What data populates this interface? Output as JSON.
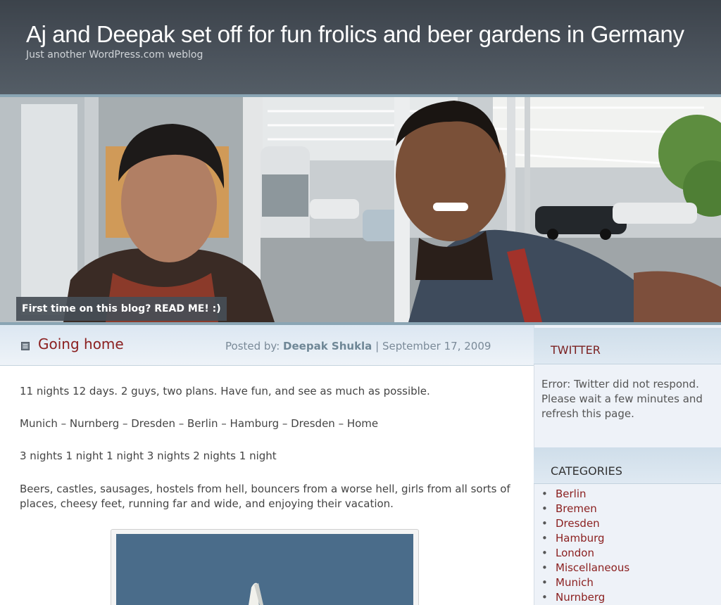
{
  "site": {
    "title": "Aj and Deepak set off for fun frolics and beer gardens in Germany",
    "description": "Just another WordPress.com weblog"
  },
  "banner": {
    "readme_label": "First time on this blog? READ ME! :)"
  },
  "post": {
    "title": "Going home",
    "posted_by_label": "Posted by:",
    "author": "Deepak Shukla",
    "separator": "|",
    "date": "September 17, 2009",
    "paragraphs": [
      "11 nights 12 days. 2 guys, two plans. Have fun, and see as much as possible.",
      "Munich – Nurnberg – Dresden – Berlin – Hamburg – Dresden – Home",
      "3 nights 1 night 1 night 3 nights 2 nights 1 night",
      "Beers, castles, sausages, hostels from hell, bouncers from a worse hell, girls from all sorts of places, cheesy feet, running far and wide, and enjoying their vacation."
    ]
  },
  "sidebar": {
    "twitter": {
      "title": "TWITTER",
      "error": "Error: Twitter did not respond. Please wait a few minutes and refresh this page."
    },
    "categories": {
      "title": "CATEGORIES",
      "items": [
        "Berlin",
        "Bremen",
        "Dresden",
        "Hamburg",
        "London",
        "Miscellaneous",
        "Munich",
        "Nurnberg"
      ]
    }
  },
  "colors": {
    "header_bg": "#444b53",
    "link": "#8b2020",
    "rule": "#8aa5b4"
  },
  "icons": {
    "post_icon": "document-icon"
  }
}
